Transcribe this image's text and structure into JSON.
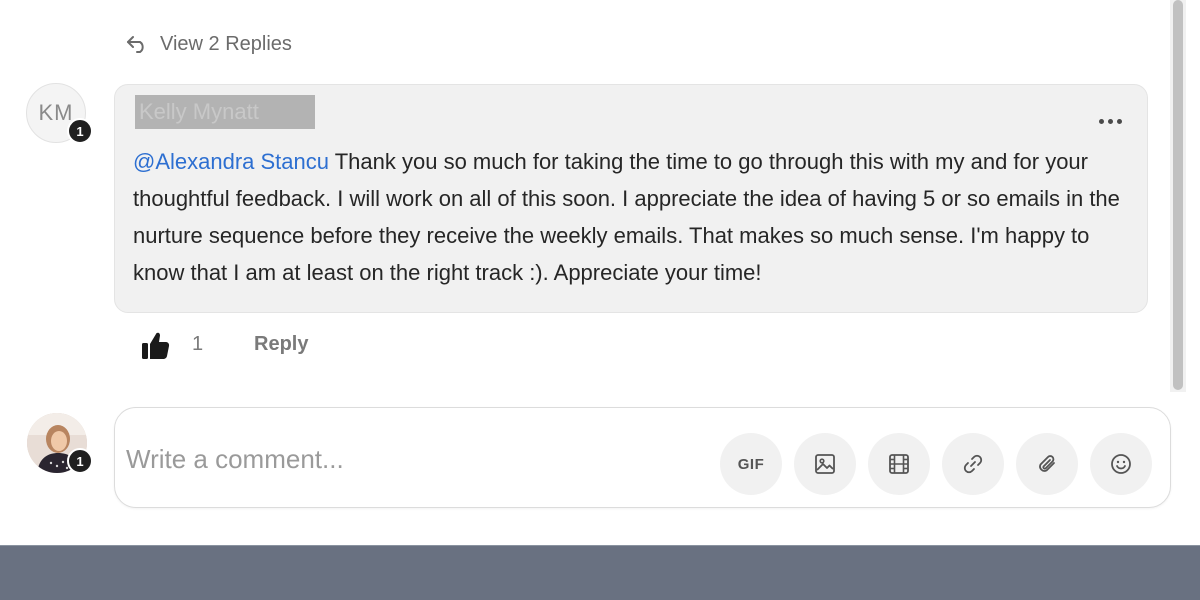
{
  "thread": {
    "view_replies_label": "View 2 Replies"
  },
  "comment": {
    "author_initials": "KM",
    "author_badge": "1",
    "author_name_redacted": "Kelly Mynatt",
    "mention": "@Alexandra Stancu",
    "body": " Thank you so much for taking the time to go through this with my and for your thoughtful feedback. I will work on all of this soon. I appreciate the idea of having 5 or so emails in the nurture sequence before they receive the weekly emails. That makes so much sense. I'm happy to know that I am at least on the right track :). Appreciate your time!",
    "like_count": "1",
    "reply_label": "Reply",
    "more_icon": "more-horizontal-icon",
    "like_icon": "thumbs-up-icon"
  },
  "composer": {
    "user_badge": "1",
    "placeholder": "Write a comment...",
    "tools": [
      {
        "label": "GIF",
        "icon": "gif-icon"
      },
      {
        "label": "",
        "icon": "image-icon"
      },
      {
        "label": "",
        "icon": "video-icon"
      },
      {
        "label": "",
        "icon": "link-icon"
      },
      {
        "label": "",
        "icon": "attachment-icon"
      },
      {
        "label": "",
        "icon": "emoji-icon"
      }
    ]
  },
  "colors": {
    "mention": "#2d6fd1",
    "bubble_bg": "#f1f1f1",
    "footer_band": "#697181",
    "badge_bg": "#202020"
  }
}
